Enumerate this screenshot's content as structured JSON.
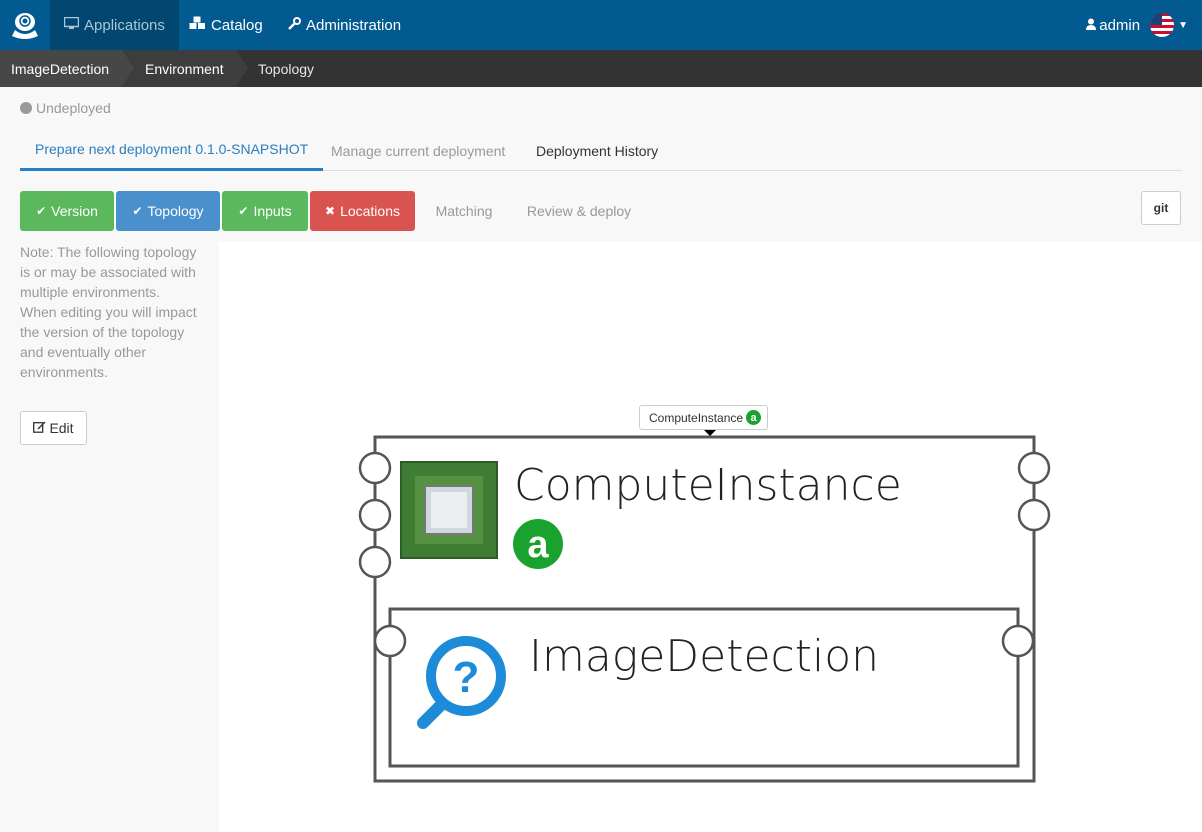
{
  "navbar": {
    "logo": "alien-logo-icon",
    "items": [
      {
        "label": "Applications",
        "icon": "monitor-icon",
        "active": true
      },
      {
        "label": "Catalog",
        "icon": "cubes-icon",
        "active": false
      },
      {
        "label": "Administration",
        "icon": "wrench-icon",
        "active": false
      }
    ],
    "user": {
      "label": "admin",
      "icon": "user-icon",
      "language": "us-flag-icon"
    }
  },
  "breadcrumb": [
    "ImageDetection",
    "Environment",
    "Topology"
  ],
  "status": {
    "label": "Undeployed",
    "color": "#999999"
  },
  "tabs": [
    {
      "label": "Prepare next deployment 0.1.0-SNAPSHOT",
      "active": true
    },
    {
      "label": "Manage current deployment",
      "active": false
    },
    {
      "label": "Deployment History",
      "active": false
    }
  ],
  "steps": [
    {
      "label": "Version",
      "state": "done",
      "color": "#5cb85c"
    },
    {
      "label": "Topology",
      "state": "current",
      "color": "#4a90cc"
    },
    {
      "label": "Inputs",
      "state": "done",
      "color": "#5cb85c"
    },
    {
      "label": "Locations",
      "state": "error",
      "color": "#d9534f"
    },
    {
      "label": "Matching",
      "state": "disabled"
    },
    {
      "label": "Review & deploy",
      "state": "disabled"
    }
  ],
  "git_button": "git",
  "note": "Note: The following topology is or may be associated with multiple environments. When editing you will impact the version of the topology and eventually other environments.",
  "edit_button": "Edit",
  "topology": {
    "tooltip": "ComputeInstance",
    "badge_letter": "a",
    "nodes": [
      {
        "name": "ComputeInstance",
        "icon": "cpu-chip-icon",
        "badge": "a"
      },
      {
        "name": "ImageDetection",
        "icon": "magnifier-question-icon"
      }
    ]
  }
}
